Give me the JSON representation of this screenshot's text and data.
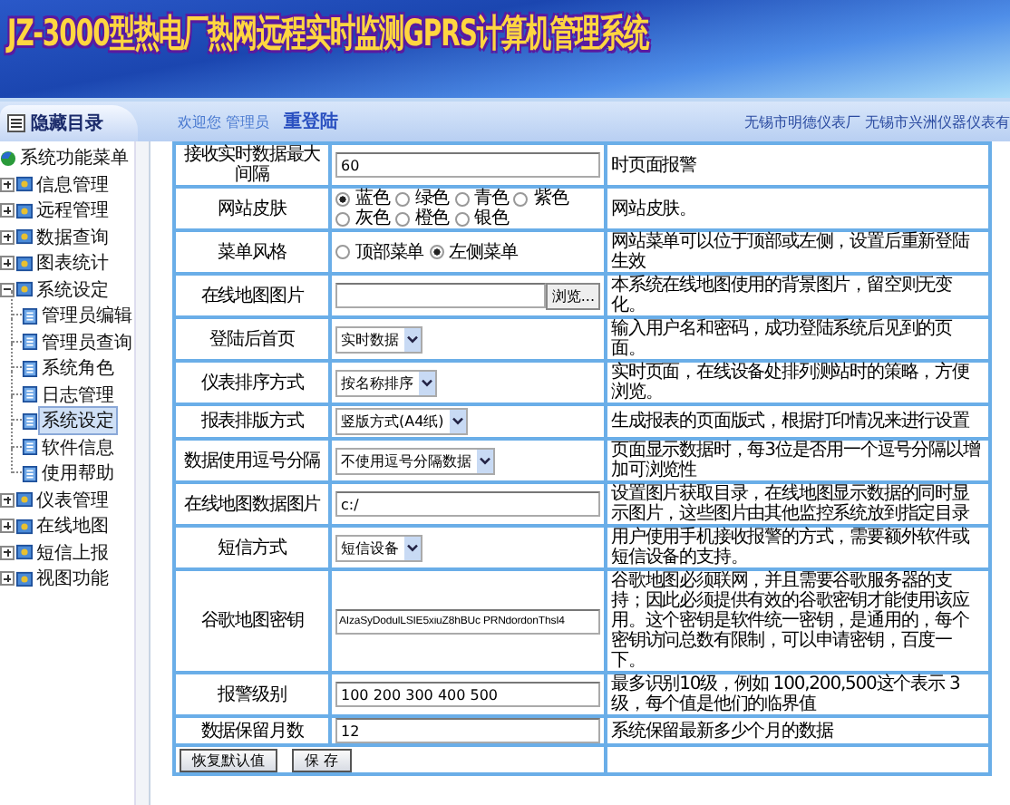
{
  "header": {
    "title": "JZ-3000型热电厂热网远程实时监测GPRS计算机管理系统"
  },
  "nav": {
    "toggle": "隐藏目录",
    "welcome": "欢迎您 管理员",
    "relogin": "重登陆",
    "company": "无锡市明德仪表厂 无锡市兴洲仪器仪表有"
  },
  "sidebar": {
    "root": "系统功能菜单",
    "items": [
      {
        "label": "信息管理",
        "expanded": false,
        "selected": false
      },
      {
        "label": "远程管理",
        "expanded": false,
        "selected": false
      },
      {
        "label": "数据查询",
        "expanded": false,
        "selected": false
      },
      {
        "label": "图表统计",
        "expanded": false,
        "selected": false
      },
      {
        "label": "系统设定",
        "expanded": true,
        "selected": false,
        "children": [
          {
            "label": "管理员编辑",
            "selected": false
          },
          {
            "label": "管理员查询",
            "selected": false
          },
          {
            "label": "系统角色",
            "selected": false
          },
          {
            "label": "日志管理",
            "selected": false
          },
          {
            "label": "系统设定",
            "selected": true
          },
          {
            "label": "软件信息",
            "selected": false
          },
          {
            "label": "使用帮助",
            "selected": false
          }
        ]
      },
      {
        "label": "仪表管理",
        "expanded": false,
        "selected": false
      },
      {
        "label": "在线地图",
        "expanded": false,
        "selected": false
      },
      {
        "label": "短信上报",
        "expanded": false,
        "selected": false
      },
      {
        "label": "视图功能",
        "expanded": false,
        "selected": false
      }
    ]
  },
  "settings": [
    {
      "kind": "text",
      "label": "接收实时数据最大间隔",
      "value": "60",
      "description": "时页面报警"
    },
    {
      "kind": "radio",
      "label": "网站皮肤",
      "options": [
        {
          "label": "蓝色",
          "selected": true
        },
        {
          "label": "绿色",
          "selected": false
        },
        {
          "label": "青色",
          "selected": false
        },
        {
          "label": "紫色",
          "selected": false
        },
        {
          "label": "灰色",
          "selected": false
        },
        {
          "label": "橙色",
          "selected": false
        },
        {
          "label": "银色",
          "selected": false
        }
      ],
      "description": "网站皮肤。"
    },
    {
      "kind": "radio",
      "label": "菜单风格",
      "options": [
        {
          "label": "顶部菜单",
          "selected": false
        },
        {
          "label": "左侧菜单",
          "selected": true
        }
      ],
      "description": "网站菜单可以位于顶部或左侧，设置后重新登陆生效"
    },
    {
      "kind": "file",
      "label": "在线地图图片",
      "button": "浏览...",
      "description": "本系统在线地图使用的背景图片，留空则无变化。"
    },
    {
      "kind": "select",
      "label": "登陆后首页",
      "value": "实时数据",
      "description": "输入用户名和密码，成功登陆系统后见到的页面。"
    },
    {
      "kind": "select",
      "label": "仪表排序方式",
      "value": "按名称排序",
      "description": "实时页面，在线设备处排列测站时的策略，方便浏览。"
    },
    {
      "kind": "select",
      "label": "报表排版方式",
      "value": "竖版方式(A4纸)",
      "description": "生成报表的页面版式，根据打印情况来进行设置"
    },
    {
      "kind": "select",
      "label": "数据使用逗号分隔",
      "value": "不使用逗号分隔数据",
      "description": "页面显示数据时，每3位是否用一个逗号分隔以增加可浏览性"
    },
    {
      "kind": "text",
      "label": "在线地图数据图片",
      "value": "c:/",
      "description": "设置图片获取目录，在线地图显示数据的同时显示图片，这些图片由其他监控系统放到指定目录"
    },
    {
      "kind": "select",
      "label": "短信方式",
      "value": "短信设备",
      "description": "用户使用手机接收报警的方式，需要额外软件或短信设备的支持。"
    },
    {
      "kind": "text",
      "label": "谷歌地图密钥",
      "value": "AIzaSyDodulLSIE5xiuZ8hBUc PRNdordonThsI4",
      "description": "谷歌地图必须联网，并且需要谷歌服务器的支持；因此必须提供有效的谷歌密钥才能使用该应用。这个密钥是软件统一密钥，是通用的，每个密钥访问总数有限制，可以申请密钥，百度一下。"
    },
    {
      "kind": "text",
      "label": "报警级别",
      "value": "100 200 300 400 500",
      "description": "最多识别10级，例如 100,200,500这个表示 3级，每个值是他们的临界值"
    },
    {
      "kind": "text",
      "label": "数据保留月数",
      "value": "12",
      "description": "系统保留最新多少个月的数据"
    }
  ],
  "buttons": [
    "恢复默认值",
    "保 存"
  ]
}
